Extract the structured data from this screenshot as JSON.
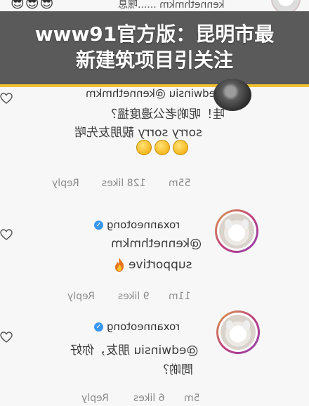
{
  "top_row": {
    "emojis": "😎😎😎",
    "text": "kennethmkm ......嘿息"
  },
  "banner": {
    "line1": "www91官方版：昆明市最",
    "line2": "新建筑项目引关注"
  },
  "comments": [
    {
      "username": "edwinsiu @kennethmkm",
      "body_line1": "哇！呢啲老公邊度搵？",
      "body_line2": "sorry sorry 靚朋友先啱",
      "time": "55m",
      "likes": "128 likes",
      "reply": "Reply"
    },
    {
      "username": "roxanneotong",
      "mention": "@kennethmkm",
      "body": "supportive",
      "time": "11m",
      "likes": "9 likes",
      "reply": "Reply"
    },
    {
      "username": "roxanneotong",
      "body_line1": "@edwinsiu 朋友，你好",
      "body_line2": "問啲？",
      "time": "5m",
      "likes": "6 likes",
      "reply": "Reply"
    }
  ],
  "colors": {
    "banner_bg": "#5a5a5a",
    "banner_accent": "#f1c232",
    "verified": "#3897f0"
  }
}
